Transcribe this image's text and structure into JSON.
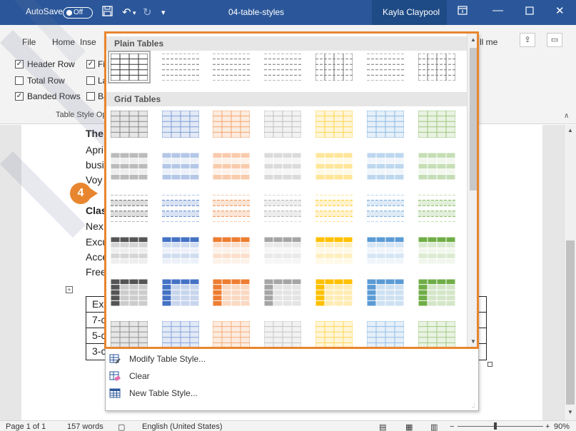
{
  "titlebar": {
    "autosave_label": "AutoSave",
    "autosave_state": "Off",
    "doc_title": "04-table-styles",
    "user_name": "Kayla Claypool",
    "qat_icons": [
      "save-icon",
      "undo-icon",
      "redo-icon",
      "customize-qat-icon"
    ],
    "window_buttons": [
      "ribbon-display-icon",
      "minimize-icon",
      "maximize-icon",
      "close-icon"
    ],
    "accent": "#2b579a"
  },
  "ribbon_tabs": {
    "items": [
      "File",
      "Home",
      "Inse"
    ],
    "tell_me": "ll me",
    "share_icon": "share-icon",
    "comments_icon": "comments-icon"
  },
  "table_style_options": {
    "col1": [
      {
        "label": "Header Row",
        "checked": true
      },
      {
        "label": "Total Row",
        "checked": false
      },
      {
        "label": "Banded Rows",
        "checked": true
      }
    ],
    "col2": [
      {
        "label": "Fi",
        "checked": true
      },
      {
        "label": "La",
        "checked": false
      },
      {
        "label": "Ba",
        "checked": false
      }
    ],
    "group_label": "Table Style Op"
  },
  "document": {
    "lines": [
      {
        "text": "The",
        "bold": true
      },
      {
        "text": "Apri",
        "bold": false
      },
      {
        "text": "busi",
        "bold": false
      },
      {
        "text": "Voy",
        "bold": false
      },
      {
        "text": "Clas",
        "bold": true
      },
      {
        "text": "Nex",
        "bold": false
      },
      {
        "text": "Excu",
        "bold": false
      },
      {
        "text": "Acce",
        "bold": false
      },
      {
        "text": "Free",
        "bold": false
      }
    ],
    "table_rows": [
      "Exc",
      "7-c",
      "5-c",
      "3-c"
    ]
  },
  "gallery": {
    "sections": [
      "Plain Tables",
      "Grid Tables"
    ],
    "commands": [
      {
        "label": "Modify Table Style...",
        "icon": "modify-table-style-icon"
      },
      {
        "label": "Clear",
        "icon": "clear-style-icon"
      },
      {
        "label": "New Table Style...",
        "icon": "new-table-style-icon"
      }
    ],
    "accent_colors": [
      "#555555",
      "#4472c4",
      "#ed7d31",
      "#a5a5a5",
      "#ffc000",
      "#5b9bd5",
      "#70ad47"
    ]
  },
  "step_badge": "4",
  "highlight_color": "#e8862f",
  "status": {
    "page": "Page 1 of 1",
    "words": "157 words",
    "language": "English (United States)",
    "zoom": "90%",
    "view_icons": [
      "read-mode-icon",
      "print-layout-icon",
      "web-layout-icon"
    ]
  }
}
